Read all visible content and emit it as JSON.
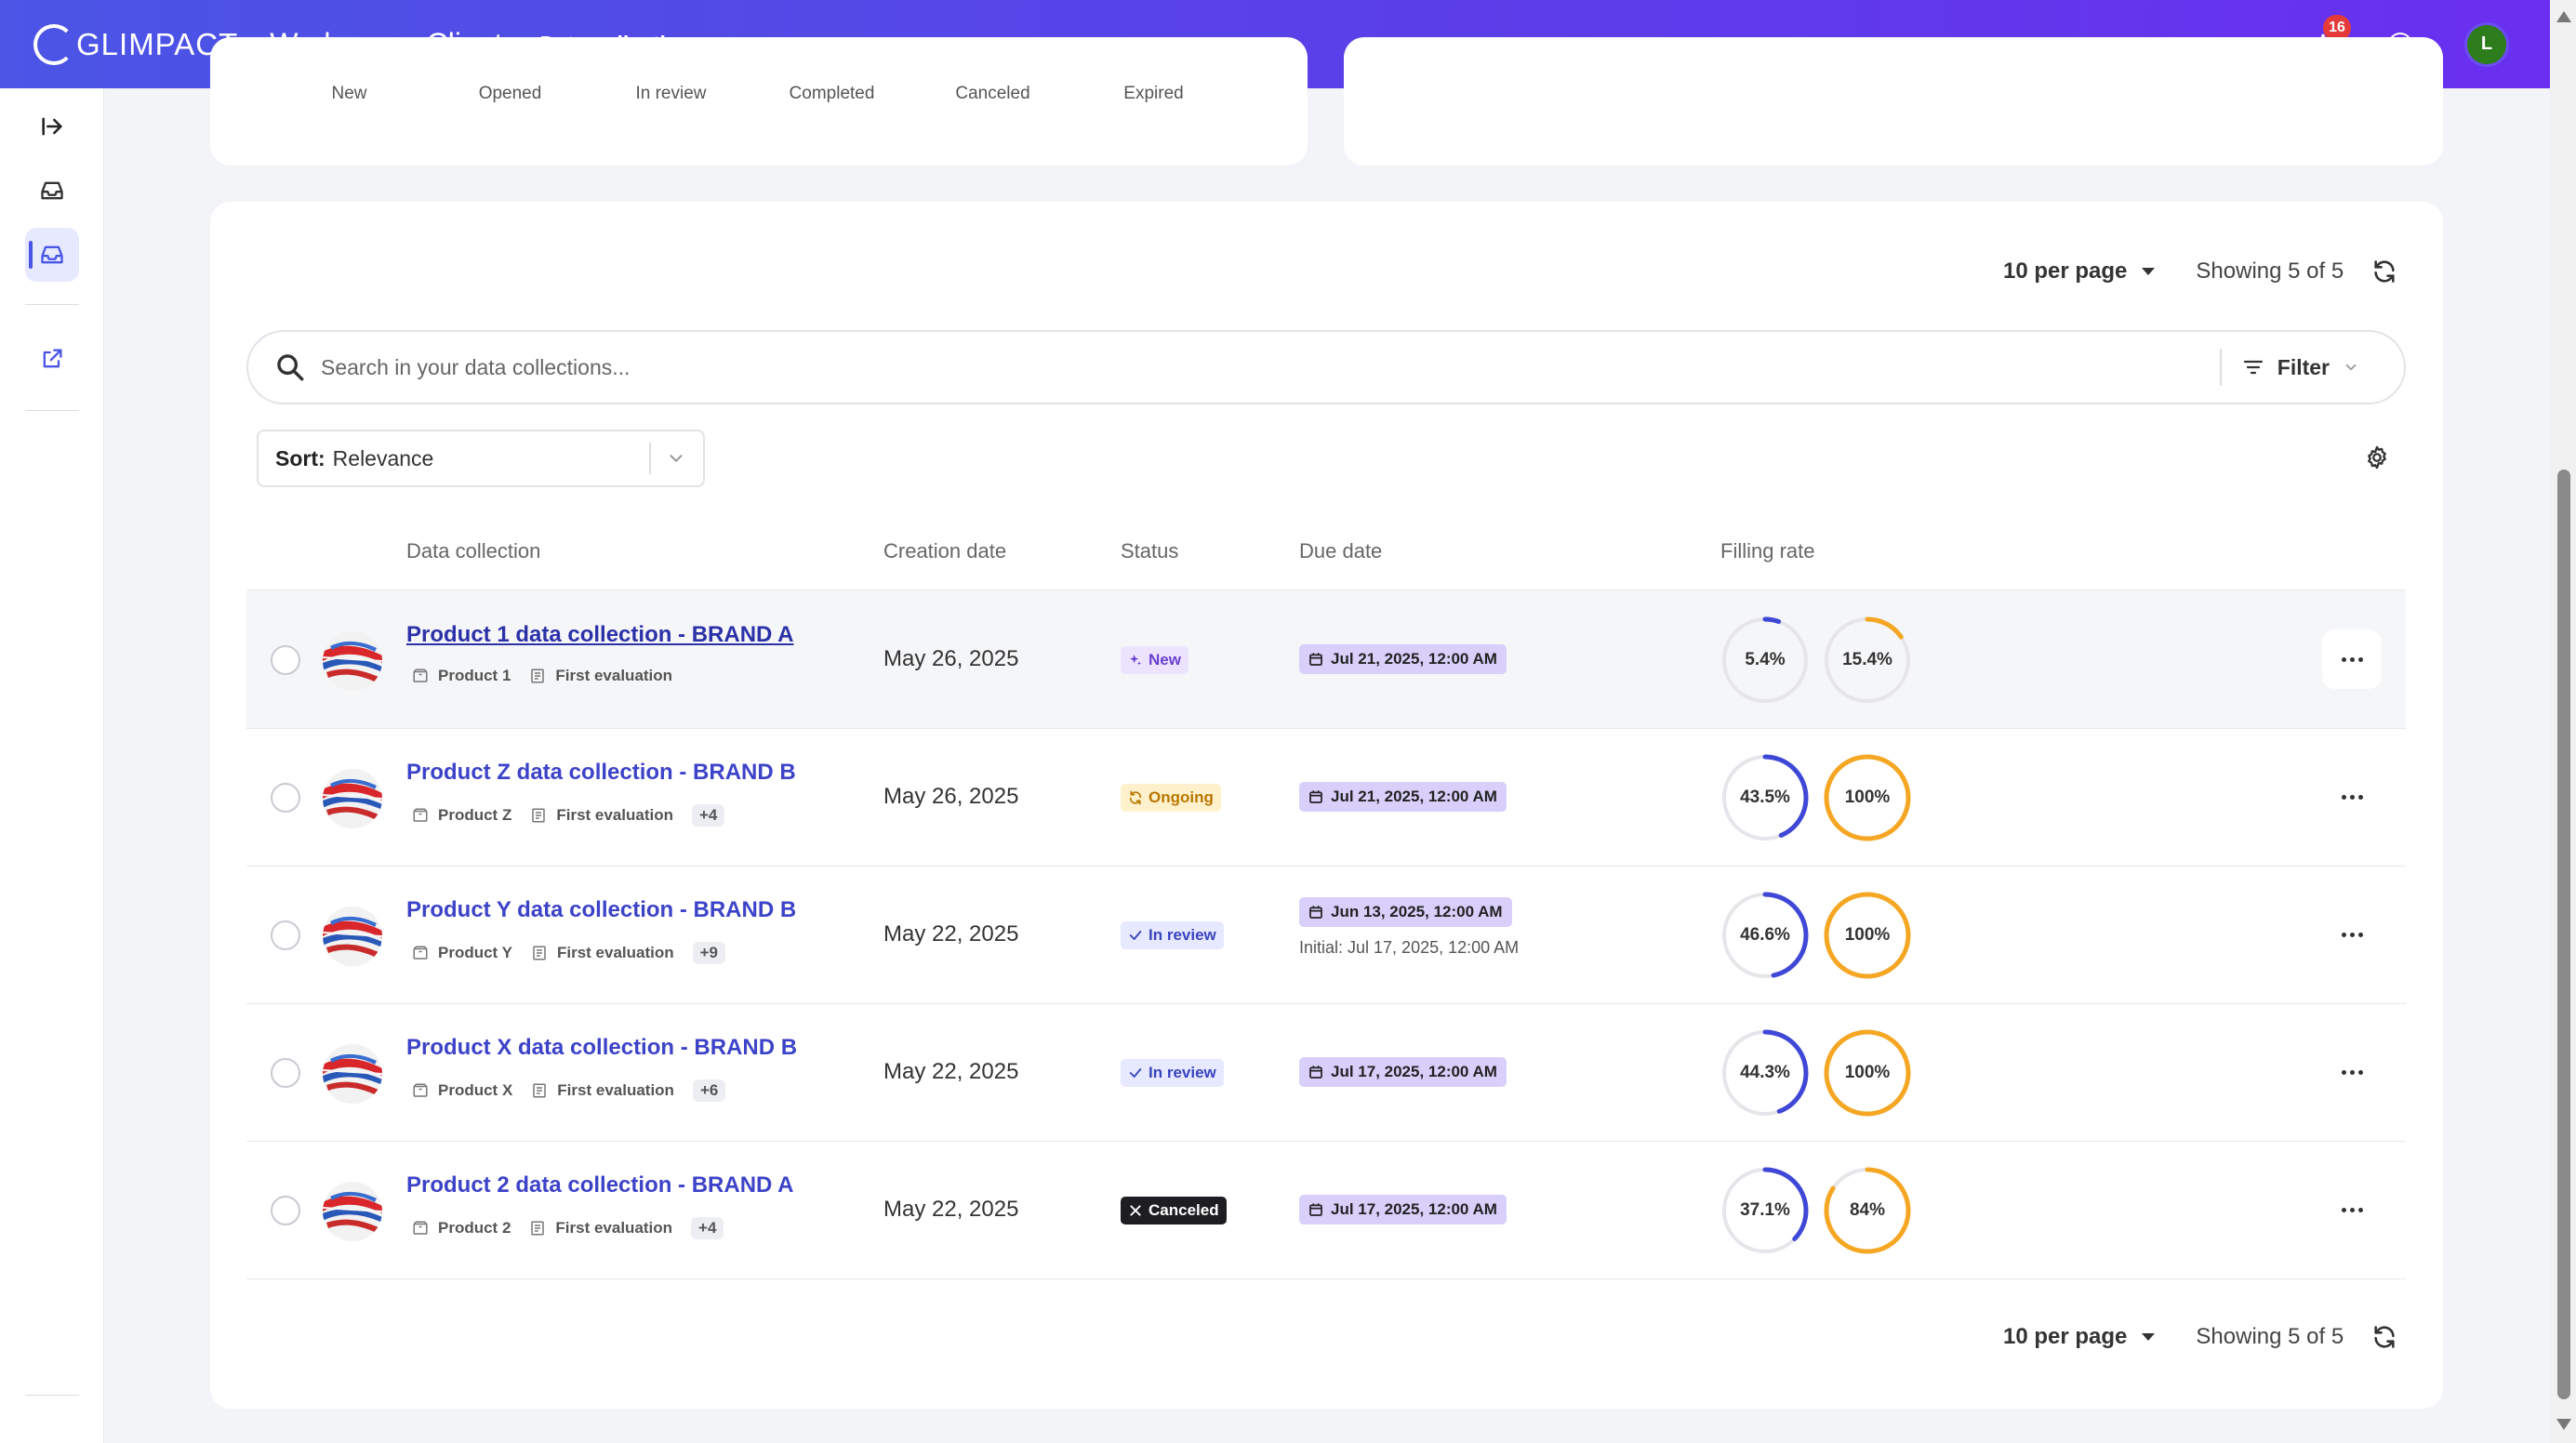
{
  "header": {
    "logo": "GLIMPACT",
    "app_title": "Workspace Client",
    "active_tab": "Data collections",
    "notifications_count": "16",
    "user_initial": "L"
  },
  "status_strip": [
    "New",
    "Opened",
    "In review",
    "Completed",
    "Canceled",
    "Expired"
  ],
  "pager": {
    "per_page": "10 per page",
    "showing": "Showing 5 of 5"
  },
  "search": {
    "placeholder": "Search in your data collections...",
    "filter_label": "Filter"
  },
  "sort": {
    "label": "Sort:",
    "value": "Relevance"
  },
  "columns": {
    "data_collection": "Data collection",
    "creation_date": "Creation date",
    "status": "Status",
    "due_date": "Due date",
    "filling_rate": "Filling rate"
  },
  "rows": [
    {
      "title": "Product 1 data collection - BRAND A",
      "product": "Product 1",
      "evaluation": "First evaluation",
      "extra": "",
      "creation_date": "May 26, 2025",
      "status": "New",
      "due_date": "Jul 21, 2025, 12:00 AM",
      "due_initial": "",
      "rate1_label": "5.4%",
      "rate1": 5.4,
      "rate2_label": "15.4%",
      "rate2": 15.4
    },
    {
      "title": "Product Z data collection - BRAND B",
      "product": "Product Z",
      "evaluation": "First evaluation",
      "extra": "+4",
      "creation_date": "May 26, 2025",
      "status": "Ongoing",
      "due_date": "Jul 21, 2025, 12:00 AM",
      "due_initial": "",
      "rate1_label": "43.5%",
      "rate1": 43.5,
      "rate2_label": "100%",
      "rate2": 100
    },
    {
      "title": "Product Y data collection - BRAND B",
      "product": "Product Y",
      "evaluation": "First evaluation",
      "extra": "+9",
      "creation_date": "May 22, 2025",
      "status": "In review",
      "due_date": "Jun 13, 2025, 12:00 AM",
      "due_initial": "Initial: Jul 17, 2025, 12:00 AM",
      "rate1_label": "46.6%",
      "rate1": 46.6,
      "rate2_label": "100%",
      "rate2": 100
    },
    {
      "title": "Product X data collection - BRAND B",
      "product": "Product X",
      "evaluation": "First evaluation",
      "extra": "+6",
      "creation_date": "May 22, 2025",
      "status": "In review",
      "due_date": "Jul 17, 2025, 12:00 AM",
      "due_initial": "",
      "rate1_label": "44.3%",
      "rate1": 44.3,
      "rate2_label": "100%",
      "rate2": 100
    },
    {
      "title": "Product 2 data collection - BRAND A",
      "product": "Product 2",
      "evaluation": "First evaluation",
      "extra": "+4",
      "creation_date": "May 22, 2025",
      "status": "Canceled",
      "due_date": "Jul 17, 2025, 12:00 AM",
      "due_initial": "",
      "rate1_label": "37.1%",
      "rate1": 37.1,
      "rate2_label": "84%",
      "rate2": 84
    }
  ],
  "colors": {
    "brand_blue": "#4b55e6",
    "rate_blue": "#3f47d6",
    "rate_orange": "#f5a623",
    "ring_track": "#e6e6ea"
  }
}
